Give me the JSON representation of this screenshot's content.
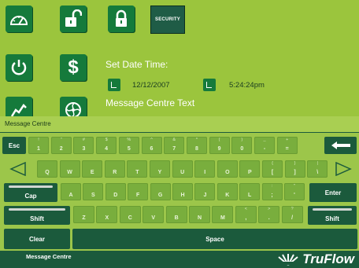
{
  "toolbar": {
    "security_label": "SECURITY"
  },
  "settings": {
    "date_time_label": "Set Date Time:",
    "date_value": "12/12/2007",
    "time_value": "5:24:24pm",
    "message_centre_text_label": "Message Centre Text"
  },
  "message_bar": {
    "text": "Message Centre"
  },
  "keyboard": {
    "row1": [
      {
        "p": "1",
        "s": "!"
      },
      {
        "p": "2",
        "s": "\""
      },
      {
        "p": "3",
        "s": "#"
      },
      {
        "p": "4",
        "s": "$"
      },
      {
        "p": "5",
        "s": "%"
      },
      {
        "p": "6",
        "s": "^"
      },
      {
        "p": "7",
        "s": "&"
      },
      {
        "p": "8",
        "s": "*"
      },
      {
        "p": "9",
        "s": "("
      },
      {
        "p": "0",
        "s": ")"
      },
      {
        "p": "-",
        "s": "_"
      },
      {
        "p": "=",
        "s": "+"
      }
    ],
    "row2": [
      {
        "p": "Q",
        "s": ""
      },
      {
        "p": "W",
        "s": ""
      },
      {
        "p": "E",
        "s": ""
      },
      {
        "p": "R",
        "s": ""
      },
      {
        "p": "T",
        "s": ""
      },
      {
        "p": "Y",
        "s": ""
      },
      {
        "p": "U",
        "s": ""
      },
      {
        "p": "I",
        "s": ""
      },
      {
        "p": "O",
        "s": ""
      },
      {
        "p": "P",
        "s": ""
      },
      {
        "p": "[",
        "s": "{"
      },
      {
        "p": "]",
        "s": "}"
      },
      {
        "p": "\\",
        "s": "|"
      }
    ],
    "row3": [
      {
        "p": "A",
        "s": ""
      },
      {
        "p": "S",
        "s": ""
      },
      {
        "p": "D",
        "s": ""
      },
      {
        "p": "F",
        "s": ""
      },
      {
        "p": "G",
        "s": ""
      },
      {
        "p": "H",
        "s": ""
      },
      {
        "p": "J",
        "s": ""
      },
      {
        "p": "K",
        "s": ""
      },
      {
        "p": "L",
        "s": ""
      },
      {
        "p": ";",
        "s": ":"
      },
      {
        "p": "'",
        "s": "\""
      }
    ],
    "row4": [
      {
        "p": "Z",
        "s": ""
      },
      {
        "p": "X",
        "s": ""
      },
      {
        "p": "C",
        "s": ""
      },
      {
        "p": "V",
        "s": ""
      },
      {
        "p": "B",
        "s": ""
      },
      {
        "p": "N",
        "s": ""
      },
      {
        "p": "M",
        "s": ""
      },
      {
        "p": ",",
        "s": "<"
      },
      {
        "p": ".",
        "s": ">"
      },
      {
        "p": "/",
        "s": "?"
      }
    ],
    "esc_label": "Esc",
    "caps_label": "Cap",
    "shift_left_label": "Shift",
    "shift_right_label": "Shift",
    "enter_label": "Enter",
    "clear_label": "Clear",
    "space_label": "Space"
  },
  "footer": {
    "text": "Message Centre",
    "logo_text": "TruFlow"
  },
  "icons": {
    "gauge": "gauge-icon",
    "unlock": "unlock-icon",
    "lock": "lock-icon",
    "power": "power-icon",
    "dollar": "dollar-icon",
    "chart": "line-chart-icon",
    "fan": "fan-icon",
    "backspace": "backspace-arrow-icon",
    "left": "left-arrow-icon",
    "right": "right-arrow-icon"
  },
  "colors": {
    "background_green": "#9bc53d",
    "dark_green": "#1b5a3c",
    "tile_green": "#157a3b",
    "key_green": "#79ae3d"
  }
}
